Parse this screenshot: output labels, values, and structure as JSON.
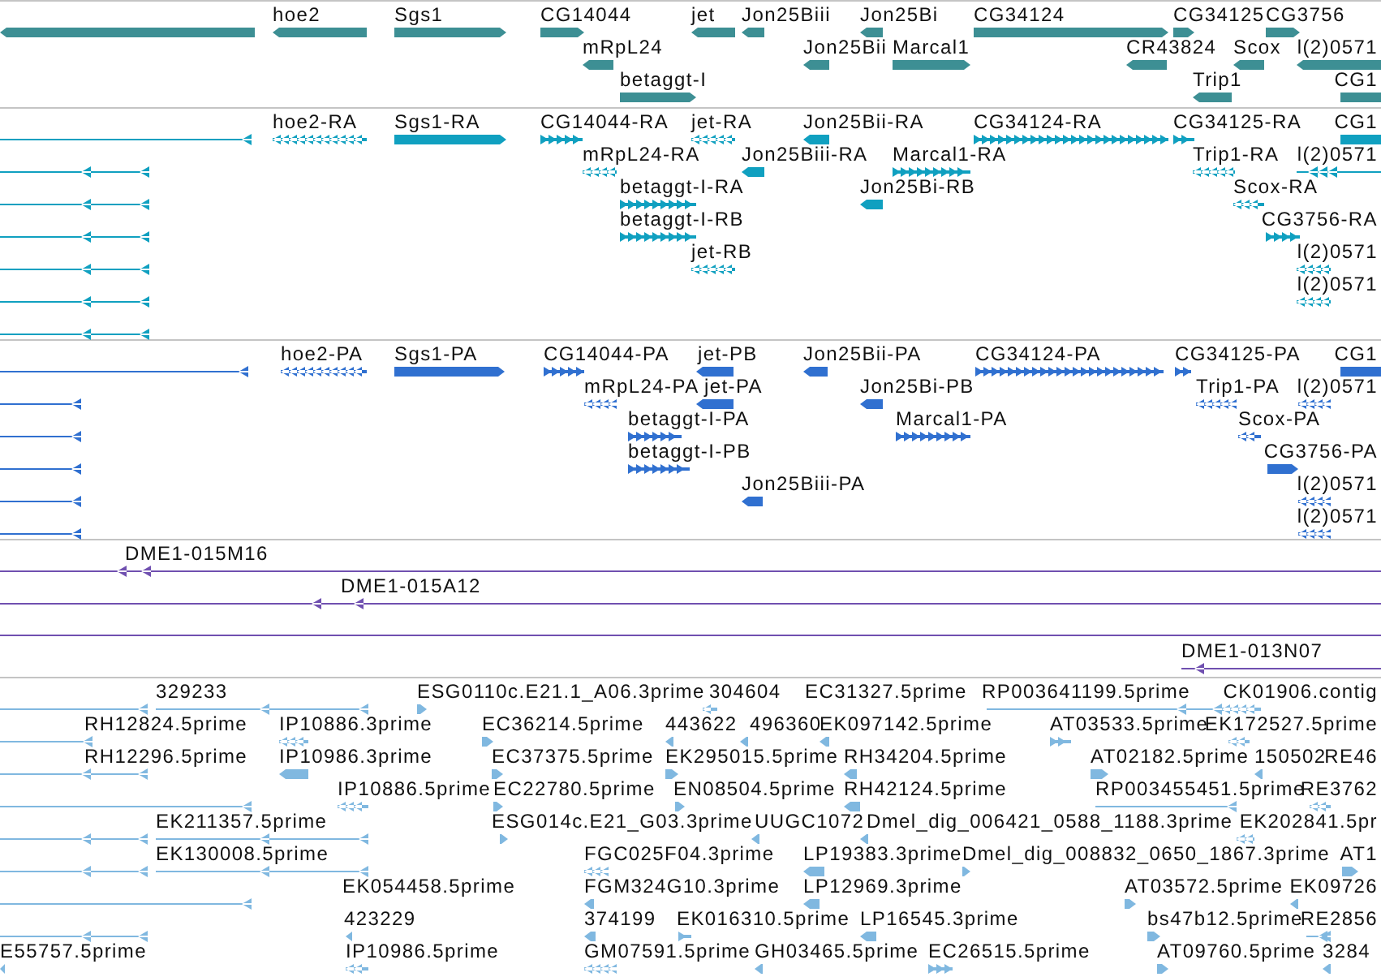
{
  "tracks": [
    {
      "color": "#3d8f94",
      "features": [
        {
          "reverse": true
        },
        {
          "label": "hoe2",
          "reverse": true
        },
        {
          "label": "Sgs1",
          "reverse": false
        },
        {
          "label": "CG14044",
          "reverse": false
        },
        {
          "label": "jet",
          "reverse": true
        },
        {
          "label": "Jon25Biii",
          "reverse": true
        },
        {
          "label": "Jon25Bi",
          "reverse": true
        },
        {
          "label": "CG34124",
          "reverse": false
        },
        {
          "label": "CG34125",
          "reverse": false
        },
        {
          "label": "CG3756",
          "reverse": false
        },
        {
          "label": "mRpL24",
          "reverse": true
        },
        {
          "label": "Jon25Bii",
          "reverse": true
        },
        {
          "label": "Marcal1",
          "reverse": false
        },
        {
          "label": "CR43824",
          "reverse": true
        },
        {
          "label": "Scox",
          "reverse": true
        },
        {
          "label": "l(2)0571",
          "reverse": true
        },
        {
          "label": "betaggt-I",
          "reverse": false
        },
        {
          "label": "Trip1",
          "reverse": true
        },
        {
          "label": "CG1"
        }
      ]
    },
    {
      "color": "#10a0c0",
      "features": [
        {
          "reverse": true
        },
        {
          "label": "hoe2-RA",
          "reverse": true
        },
        {
          "label": "Sgs1-RA",
          "reverse": false
        },
        {
          "label": "CG14044-RA",
          "reverse": false
        },
        {
          "label": "jet-RA",
          "reverse": true
        },
        {
          "label": "Jon25Bii-RA",
          "reverse": true
        },
        {
          "label": "CG34124-RA",
          "reverse": false
        },
        {
          "label": "CG34125-RA",
          "reverse": false
        },
        {
          "label": "CG1"
        },
        {
          "reverse": true
        },
        {
          "label": "mRpL24-RA",
          "reverse": true
        },
        {
          "label": "Jon25Biii-RA",
          "reverse": true
        },
        {
          "label": "Marcal1-RA",
          "reverse": false
        },
        {
          "label": "Trip1-RA",
          "reverse": true
        },
        {
          "label": "l(2)0571",
          "reverse": true
        },
        {
          "reverse": true
        },
        {
          "label": "betaggt-I-RA",
          "reverse": false
        },
        {
          "label": "Jon25Bi-RB",
          "reverse": true
        },
        {
          "label": "Scox-RA",
          "reverse": true
        },
        {
          "reverse": true
        },
        {
          "label": "betaggt-I-RB",
          "reverse": false
        },
        {
          "label": "CG3756-RA",
          "reverse": false
        },
        {
          "reverse": true
        },
        {
          "label": "jet-RB",
          "reverse": true
        },
        {
          "label": "l(2)0571",
          "reverse": true
        },
        {
          "reverse": true
        },
        {
          "label": "l(2)0571",
          "reverse": true
        },
        {
          "reverse": true
        }
      ]
    },
    {
      "color": "#3070d0",
      "features": [
        {
          "reverse": true
        },
        {
          "label": "hoe2-PA",
          "reverse": true
        },
        {
          "label": "Sgs1-PA",
          "reverse": false
        },
        {
          "label": "CG14044-PA",
          "reverse": false
        },
        {
          "label": "jet-PB",
          "reverse": true
        },
        {
          "label": "Jon25Bii-PA",
          "reverse": true
        },
        {
          "label": "CG34124-PA",
          "reverse": false
        },
        {
          "label": "CG34125-PA",
          "reverse": false
        },
        {
          "label": "CG1"
        },
        {
          "reverse": true
        },
        {
          "label": "mRpL24-PA",
          "reverse": true
        },
        {
          "label": "jet-PA",
          "reverse": true
        },
        {
          "label": "Jon25Bi-PB",
          "reverse": true
        },
        {
          "label": "Trip1-PA",
          "reverse": true
        },
        {
          "label": "l(2)0571",
          "reverse": true
        },
        {
          "reverse": true
        },
        {
          "label": "betaggt-I-PA",
          "reverse": false
        },
        {
          "label": "Marcal1-PA",
          "reverse": false
        },
        {
          "label": "Scox-PA",
          "reverse": true
        },
        {
          "reverse": true
        },
        {
          "label": "betaggt-I-PB",
          "reverse": false
        },
        {
          "label": "CG3756-PA",
          "reverse": false
        },
        {
          "reverse": true
        },
        {
          "label": "Jon25Biii-PA",
          "reverse": true
        },
        {
          "label": "l(2)0571",
          "reverse": true
        },
        {
          "reverse": true
        },
        {
          "label": "l(2)0571",
          "reverse": true
        }
      ]
    },
    {
      "color": "#7050b0",
      "features": [
        {
          "label": "DME1-015M16",
          "reverse": true
        },
        {
          "label": "DME1-015A12",
          "reverse": true
        },
        {
          "label": "DME1-013N07",
          "reverse": true
        }
      ]
    },
    {
      "color": "#80b8e0",
      "features": [
        {
          "reverse": true
        },
        {
          "label": "329233",
          "reverse": true
        },
        {
          "label": "ESG0110c.E21.1_A06.3prime",
          "reverse": false
        },
        {
          "label": "304604",
          "reverse": true
        },
        {
          "label": "EC31327.5prime"
        },
        {
          "label": "RP003641199.5prime",
          "reverse": true
        },
        {
          "label": "CK01906.contig",
          "reverse": true
        },
        {
          "reverse": true
        },
        {
          "label": "RH12824.5prime"
        },
        {
          "label": "IP10886.3prime",
          "reverse": true
        },
        {
          "label": "EC36214.5prime",
          "reverse": false
        },
        {
          "label": "443622",
          "reverse": true
        },
        {
          "label": "496360",
          "reverse": true
        },
        {
          "label": "EK097142.5prime",
          "reverse": true
        },
        {
          "label": "AT03533.5prime",
          "reverse": false
        },
        {
          "label": "EK172527.5prime",
          "reverse": true
        },
        {
          "reverse": true
        },
        {
          "label": "RH12296.5prime"
        },
        {
          "label": "IP10986.3prime",
          "reverse": true
        },
        {
          "label": "EC37375.5prime",
          "reverse": false
        },
        {
          "label": "EK295015.5prime",
          "reverse": false
        },
        {
          "label": "RH34204.5prime",
          "reverse": true
        },
        {
          "label": "AT02182.5prime",
          "reverse": false
        },
        {
          "label": "150502",
          "reverse": true
        },
        {
          "label": "RE46"
        },
        {
          "reverse": true
        },
        {
          "label": "IP10886.5prime",
          "reverse": true
        },
        {
          "label": "EC22780.5prime",
          "reverse": false
        },
        {
          "label": "EN08504.5prime",
          "reverse": false
        },
        {
          "label": "RH42124.5prime",
          "reverse": true
        },
        {
          "label": "RP003455451.5prime",
          "reverse": true
        },
        {
          "label": "RE3762",
          "reverse": true
        },
        {
          "reverse": true
        },
        {
          "label": "EK211357.5prime",
          "reverse": true
        },
        {
          "label": "ESG014c.E21_G03.3prime",
          "reverse": false
        },
        {
          "label": "UUGC1072",
          "reverse": true
        },
        {
          "label": "Dmel_dig_006421_0588_1188.3prime",
          "reverse": true
        },
        {
          "label": "EK202841.5pr",
          "reverse": true
        },
        {
          "reverse": true
        },
        {
          "label": "EK130008.5prime",
          "reverse": true
        },
        {
          "label": "FGC025F04.3prime",
          "reverse": true
        },
        {
          "label": "LP19383.3prime",
          "reverse": true
        },
        {
          "label": "Dmel_dig_008832_0650_1867.3prime",
          "reverse": false
        },
        {
          "label": "AT1",
          "reverse": false
        },
        {
          "reverse": true
        },
        {
          "label": "EK054458.5prime"
        },
        {
          "label": "FGM324G10.3prime",
          "reverse": true
        },
        {
          "label": "LP12969.3prime",
          "reverse": true
        },
        {
          "label": "AT03572.5prime",
          "reverse": false
        },
        {
          "label": "EK09726",
          "reverse": true
        },
        {
          "reverse": true
        },
        {
          "label": "423229",
          "reverse": true
        },
        {
          "label": "374199",
          "reverse": true
        },
        {
          "label": "EK016310.5prime",
          "reverse": false
        },
        {
          "label": "LP16545.3prime",
          "reverse": true
        },
        {
          "label": "bs47b12.5prime",
          "reverse": false
        },
        {
          "label": "RE2856",
          "reverse": true
        },
        {
          "label": "E55757.5prime",
          "reverse": true
        },
        {
          "label": "IP10986.5prime",
          "reverse": true
        },
        {
          "label": "GM07591.5prime",
          "reverse": true
        },
        {
          "label": "GH03465.5prime",
          "reverse": true
        },
        {
          "label": "EC26515.5prime",
          "reverse": false
        },
        {
          "label": "AT09760.5prime",
          "reverse": false
        },
        {
          "label": "3284",
          "reverse": true
        }
      ]
    }
  ]
}
